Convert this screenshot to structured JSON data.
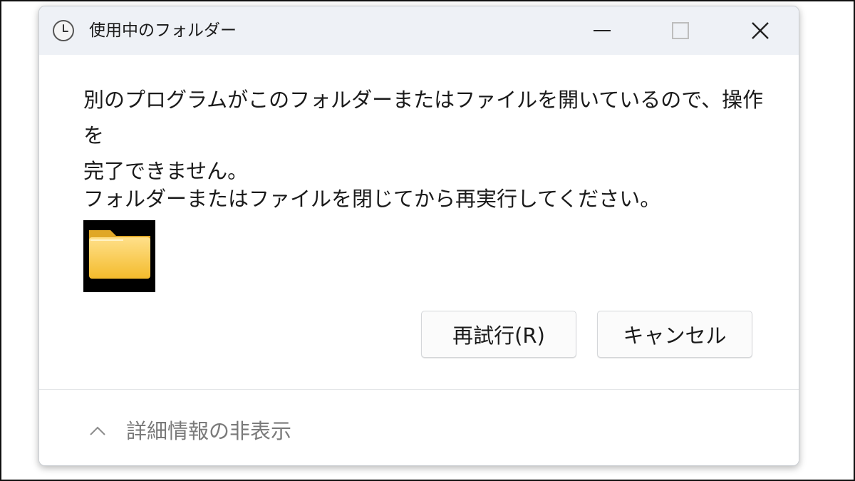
{
  "window": {
    "title": "使用中のフォルダー",
    "title_icon": "clock-icon",
    "controls": {
      "minimize": "minimize-icon",
      "maximize": "maximize-icon",
      "close": "close-icon"
    }
  },
  "message": {
    "line1": "別のプログラムがこのフォルダーまたはファイルを開いているので、操作を\n完了できません。",
    "line2": "フォルダーまたはファイルを閉じてから再実行してください。"
  },
  "thumbnail": {
    "icon": "folder-icon",
    "background": "#000000",
    "folder_color": "#f6c945"
  },
  "buttons": {
    "retry_label": "再試行(R)",
    "cancel_label": "キャンセル"
  },
  "footer": {
    "details_label": "詳細情報の非表示",
    "toggle_icon": "chevron-up-icon"
  }
}
